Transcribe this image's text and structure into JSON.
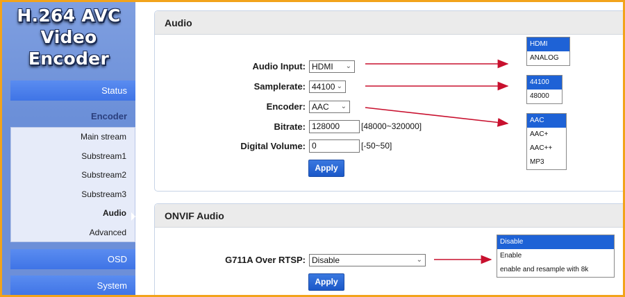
{
  "logo": {
    "line1": "H.264 AVC",
    "line2": "Video Encoder"
  },
  "sidebar": {
    "status": "Status",
    "encoder": "Encoder",
    "items": [
      {
        "label": "Main stream"
      },
      {
        "label": "Substream1"
      },
      {
        "label": "Substream2"
      },
      {
        "label": "Substream3"
      },
      {
        "label": "Audio"
      },
      {
        "label": "Advanced"
      }
    ],
    "osd": "OSD",
    "system": "System"
  },
  "audio": {
    "title": "Audio",
    "input_label": "Audio Input:",
    "input_value": "HDMI",
    "samplerate_label": "Samplerate:",
    "samplerate_value": "44100",
    "encoder_label": "Encoder:",
    "encoder_value": "AAC",
    "bitrate_label": "Bitrate:",
    "bitrate_value": "128000",
    "bitrate_range": "[48000~320000]",
    "volume_label": "Digital Volume:",
    "volume_value": "0",
    "volume_range": "[-50~50]",
    "apply": "Apply"
  },
  "onvif": {
    "title": "ONVIF Audio",
    "g711_label": "G711A Over RTSP:",
    "g711_value": "Disable",
    "apply": "Apply"
  },
  "callouts": {
    "input_options": [
      "HDMI",
      "ANALOG"
    ],
    "samplerate_options": [
      "44100",
      "48000"
    ],
    "encoder_options": [
      "AAC",
      "AAC+",
      "AAC++",
      "MP3"
    ],
    "g711_options": [
      "Disable",
      "Enable",
      "enable and resample with 8k"
    ]
  },
  "colors": {
    "accent": "#1e62d6",
    "arrow": "#c8102e",
    "border": "#f2a31b"
  }
}
